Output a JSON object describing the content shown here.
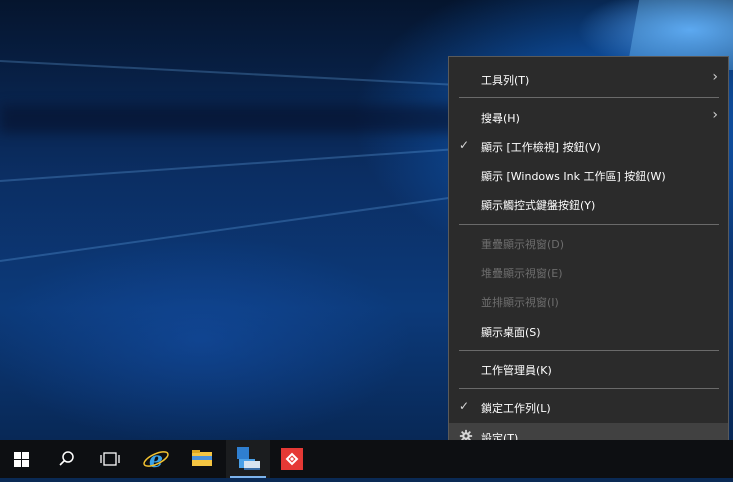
{
  "context_menu": {
    "items": [
      {
        "label": "工具列(T)"
      },
      {
        "label": "搜尋(H)"
      },
      {
        "label": "顯示 [工作檢視] 按鈕(V)"
      },
      {
        "label": "顯示 [Windows Ink 工作區] 按鈕(W)"
      },
      {
        "label": "顯示觸控式鍵盤按鈕(Y)"
      },
      {
        "label": "重疊顯示視窗(D)"
      },
      {
        "label": "堆疊顯示視窗(E)"
      },
      {
        "label": "並排顯示視窗(I)"
      },
      {
        "label": "顯示桌面(S)"
      },
      {
        "label": "工作管理員(K)"
      },
      {
        "label": "鎖定工作列(L)"
      },
      {
        "label": "設定(T)"
      }
    ]
  },
  "taskbar": {
    "icons": [
      "windows-start-icon",
      "search-icon",
      "task-view-icon",
      "internet-explorer-icon",
      "file-explorer-icon",
      "store-app-icon",
      "red-app-icon"
    ]
  },
  "colors": {
    "menu_bg": "#2b2b2b",
    "menu_hover": "#414141",
    "taskbar_bg": "#0d0f12",
    "accent": "#7cb3ec"
  }
}
